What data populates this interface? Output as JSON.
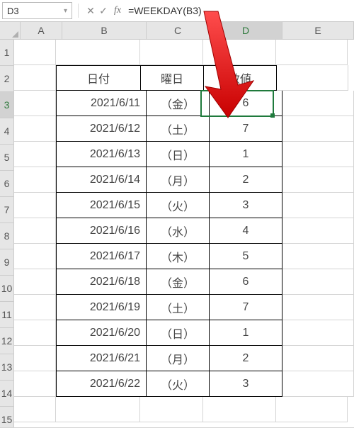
{
  "namebox": "D3",
  "formula": "=WEEKDAY(B3)",
  "icons": {
    "cancel": "✕",
    "enter": "✓",
    "fx": "fx",
    "dropdown": "▾"
  },
  "colWidths": {
    "A": 58,
    "B": 118,
    "C": 88,
    "D": 102,
    "E": 100
  },
  "columns": [
    "A",
    "B",
    "C",
    "D",
    "E"
  ],
  "selectedCol": "D",
  "selectedRow": 3,
  "rowCount": 15,
  "headers": {
    "B": "日付",
    "C": "曜日",
    "D": "数値"
  },
  "chart_data": {
    "type": "table",
    "columns": [
      "日付",
      "曜日",
      "数値"
    ],
    "rows": [
      {
        "date": "2021/6/11",
        "weekday": "（金）",
        "value": 6
      },
      {
        "date": "2021/6/12",
        "weekday": "（土）",
        "value": 7
      },
      {
        "date": "2021/6/13",
        "weekday": "（日）",
        "value": 1
      },
      {
        "date": "2021/6/14",
        "weekday": "（月）",
        "value": 2
      },
      {
        "date": "2021/6/15",
        "weekday": "（火）",
        "value": 3
      },
      {
        "date": "2021/6/16",
        "weekday": "（水）",
        "value": 4
      },
      {
        "date": "2021/6/17",
        "weekday": "（木）",
        "value": 5
      },
      {
        "date": "2021/6/18",
        "weekday": "（金）",
        "value": 6
      },
      {
        "date": "2021/6/19",
        "weekday": "（土）",
        "value": 7
      },
      {
        "date": "2021/6/20",
        "weekday": "（日）",
        "value": 1
      },
      {
        "date": "2021/6/21",
        "weekday": "（月）",
        "value": 2
      },
      {
        "date": "2021/6/22",
        "weekday": "（火）",
        "value": 3
      }
    ]
  }
}
